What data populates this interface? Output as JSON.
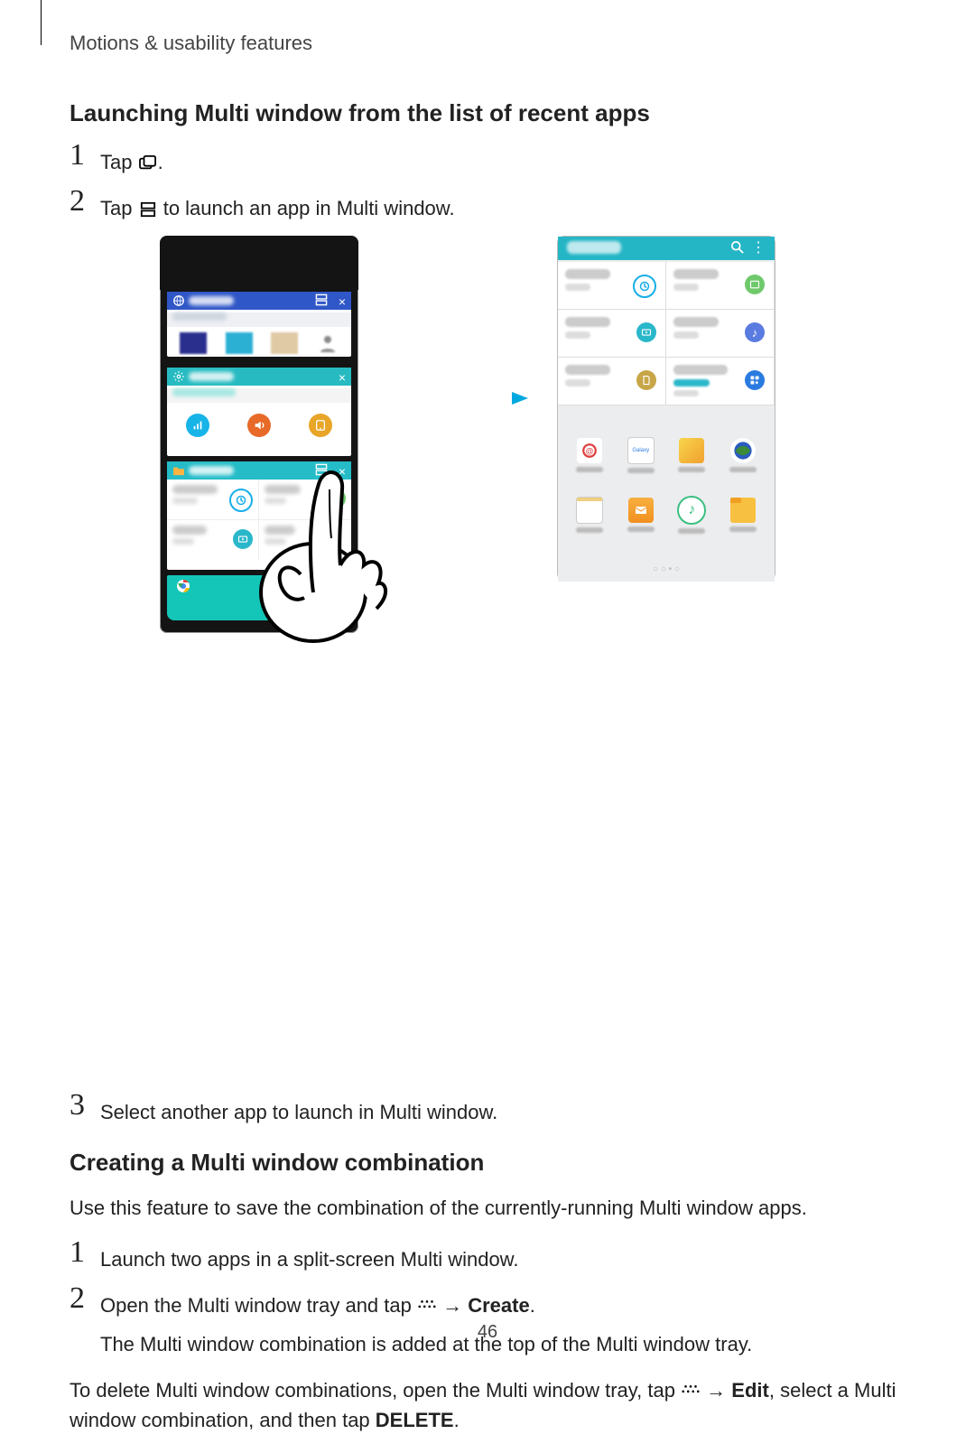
{
  "header": "Motions & usability features",
  "section1": {
    "title": "Launching Multi window from the list of recent apps",
    "step1a": "Tap ",
    "step1b": ".",
    "step2a": "Tap ",
    "step2b": " to launch an app in Multi window.",
    "step3": "Select another app to launch in Multi window."
  },
  "section2": {
    "title": "Creating a Multi window combination",
    "intro": "Use this feature to save the combination of the currently-running Multi window apps.",
    "step1": "Launch two apps in a split-screen Multi window.",
    "step2a": "Open the Multi window tray and tap ",
    "step2arrow": " → ",
    "step2b": "Create",
    "step2c": ".",
    "step2note": "The Multi window combination is added at the top of the Multi window tray.",
    "outro1": "To delete Multi window combinations, open the Multi window tray, tap ",
    "outroarrow": " → ",
    "outro2": "Edit",
    "outro3": ", select a Multi window combination, and then tap ",
    "outro4": "DELETE",
    "outro5": "."
  },
  "pageNumber": "46",
  "nums": {
    "n1": "1",
    "n2": "2",
    "n3": "3"
  }
}
